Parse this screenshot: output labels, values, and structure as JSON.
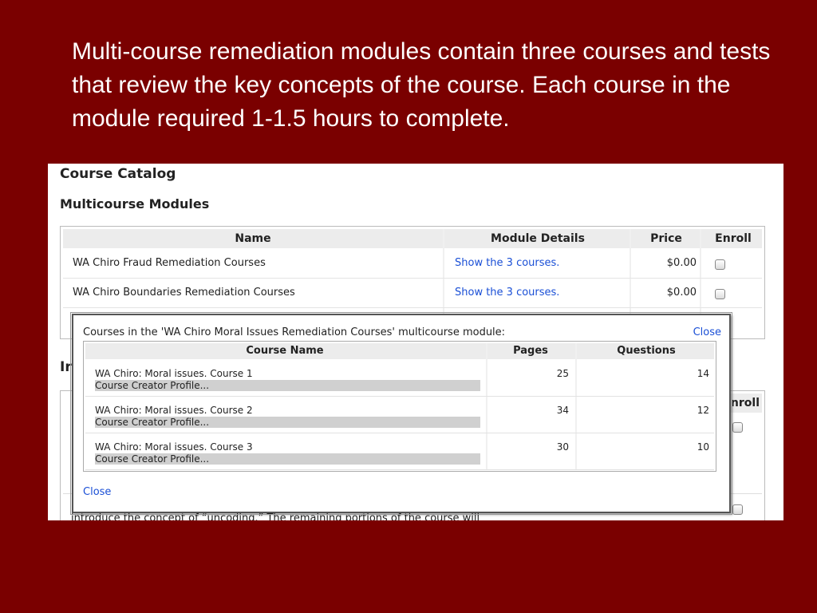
{
  "slide": {
    "text": "Multi-course remediation modules contain three courses and tests that review the key concepts of the course. Each course in the module required 1-1.5 hours to complete."
  },
  "catalog": {
    "title": "Course Catalog",
    "section_multicourse": "Multicourse Modules",
    "section_intro_partial": "Ir",
    "columns": {
      "name": "Name",
      "details": "Module Details",
      "price": "Price",
      "enroll": "Enroll"
    },
    "rows": [
      {
        "name": "WA Chiro Fraud Remediation Courses",
        "details_link": "Show the 3 courses.",
        "price": "$0.00"
      },
      {
        "name": "WA Chiro Boundaries Remediation Courses",
        "details_link": "Show the 3 courses.",
        "price": "$0.00"
      }
    ],
    "bg_enroll_partial": "nroll",
    "bg_snippet": "introduce the concept of “uncoding.” The remaining portions of the course will"
  },
  "popup": {
    "title": "Courses in the 'WA Chiro Moral Issues Remediation Courses' multicourse module:",
    "close_label": "Close",
    "columns": {
      "course_name": "Course Name",
      "pages": "Pages",
      "questions": "Questions"
    },
    "courses": [
      {
        "name": "WA Chiro: Moral issues. Course 1",
        "profile_link": "Course Creator Profile...",
        "pages": "25",
        "questions": "14"
      },
      {
        "name": "WA Chiro: Moral issues. Course 2",
        "profile_link": "Course Creator Profile...",
        "pages": "34",
        "questions": "12"
      },
      {
        "name": "WA Chiro: Moral issues. Course 3",
        "profile_link": "Course Creator Profile...",
        "pages": "30",
        "questions": "10"
      }
    ]
  },
  "colors": {
    "background": "#7a0000",
    "link": "#1a4fd6"
  }
}
